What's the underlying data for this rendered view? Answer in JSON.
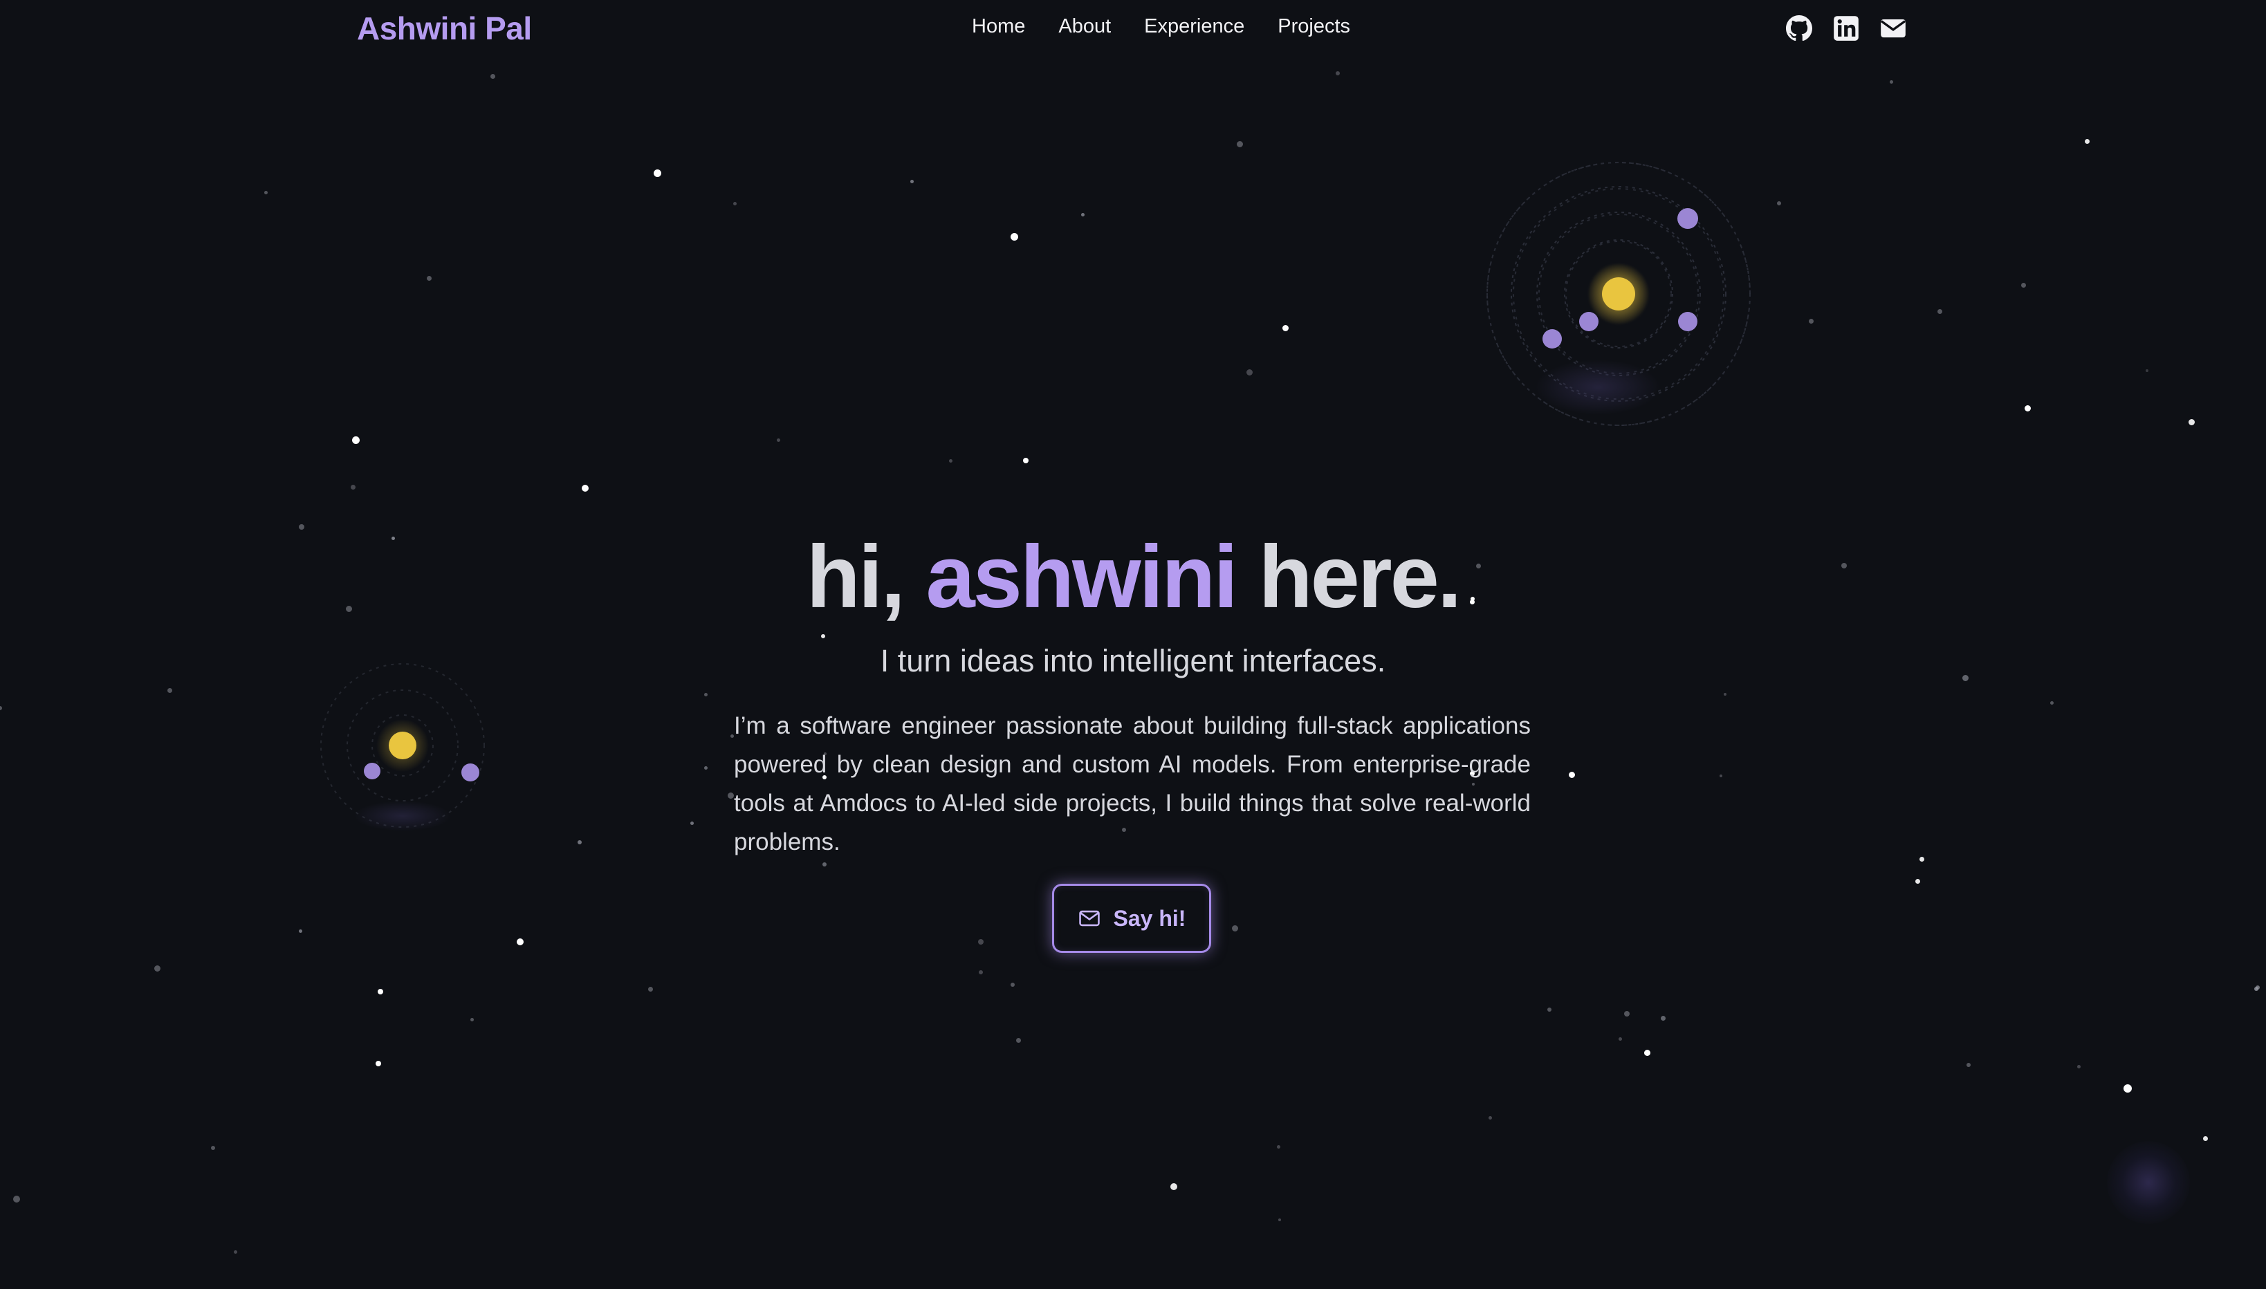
{
  "brand": "Ashwini Pal",
  "nav": {
    "items": [
      "Home",
      "About",
      "Experience",
      "Projects"
    ]
  },
  "social": {
    "icons": [
      "github-icon",
      "linkedin-icon",
      "mail-icon"
    ]
  },
  "hero": {
    "greeting": "hi,",
    "name": "ashwini",
    "tail": "here.",
    "subtitle": "I turn ideas into intelligent interfaces.",
    "body": "I’m a software engineer passionate about building full-stack applications powered by clean design and custom AI models. From enterprise-grade tools at Amdocs to AI-led side projects, I build things that solve real-world problems.",
    "cta_label": "Say hi!",
    "cta_icon": "mail-icon"
  },
  "colors": {
    "background": "#0e1015",
    "accent": "#b59cf0",
    "sun": "#e9c53f",
    "planet": "#9b86d4"
  }
}
